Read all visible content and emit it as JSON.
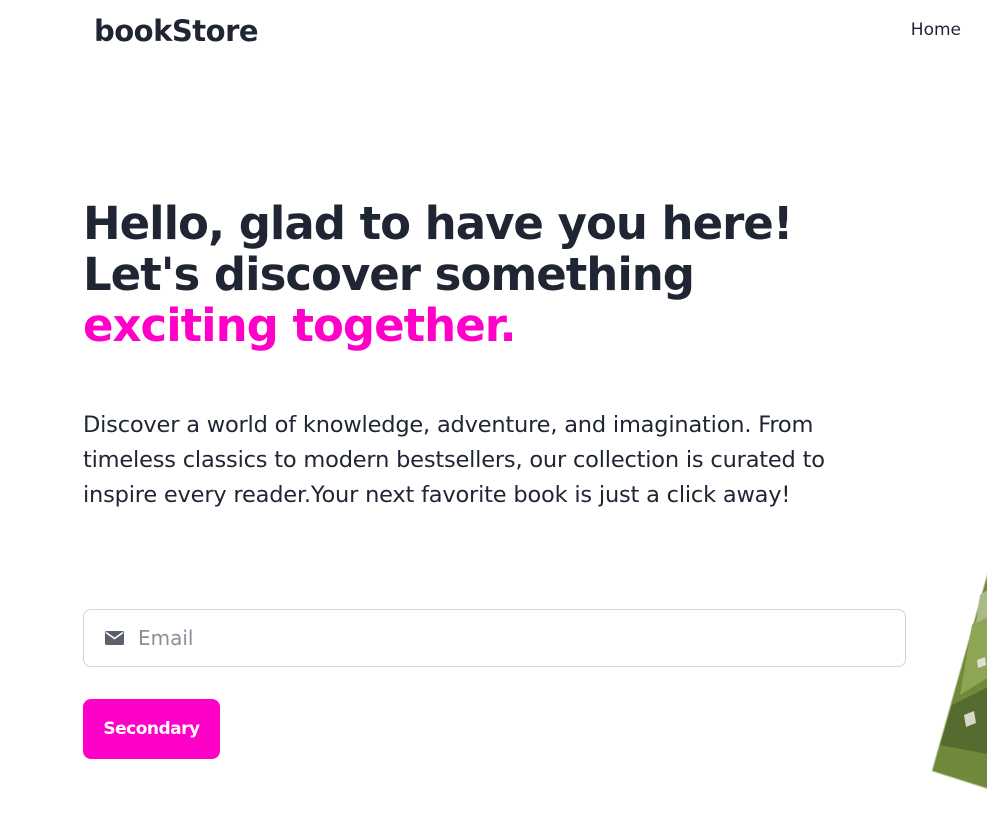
{
  "header": {
    "brand": "bookStore",
    "nav": {
      "home_label": "Home"
    }
  },
  "hero": {
    "title_line1": "Hello, glad to have you here!",
    "title_line2": "Let's discover something",
    "title_accent": "exciting together.",
    "description": "Discover a world of knowledge, adventure, and imagination. From timeless classics to modern bestsellers, our collection is curated to inspire every reader.Your next favorite book is just a click away!"
  },
  "form": {
    "email_placeholder": "Email",
    "email_value": "",
    "email_icon": "envelope-icon",
    "button_label": "Secondary"
  },
  "colors": {
    "accent": "#ff00c8",
    "text": "#1f2533",
    "border": "#cfd3da",
    "placeholder": "#8a8f99"
  }
}
